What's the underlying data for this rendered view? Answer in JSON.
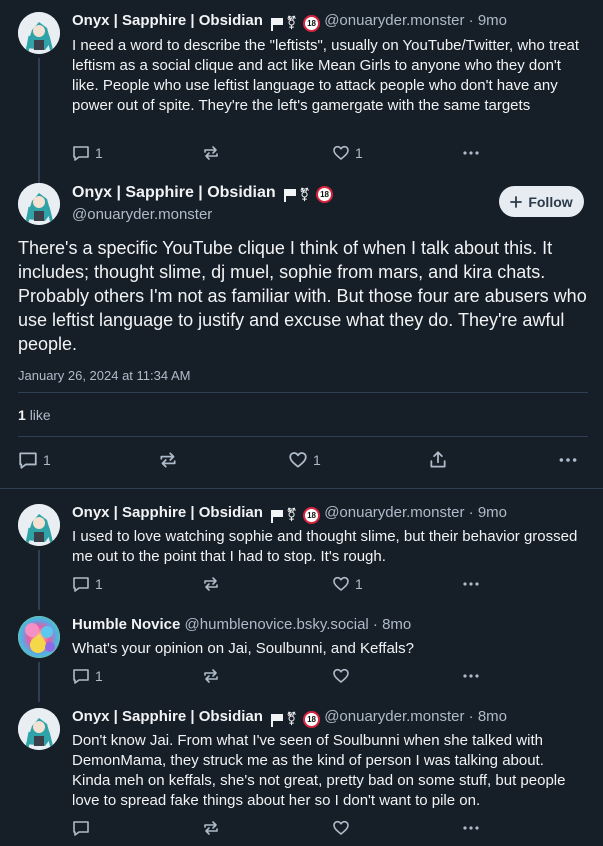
{
  "posts": [
    {
      "name": "Onyx | Sapphire | Obsidian",
      "handle": "@onuaryder.monster",
      "time": "9mo",
      "text": "I need a word to describe the \"leftists\", usually on YouTube/Twitter, who treat leftism as a social clique and act like Mean Girls to anyone who they don't like. People who use leftist language to attack people who don't have any power out of spite. They're the left's gamergate with the same targets",
      "replies": "1",
      "likes": "1"
    },
    {
      "name": "Onyx | Sapphire | Obsidian",
      "handle": "@onuaryder.monster",
      "time": "9mo",
      "text": "I used to love watching sophie and thought slime, but their behavior grossed me out to the point that I had to stop. It's rough.",
      "replies": "1",
      "likes": "1"
    },
    {
      "name": "Humble Novice",
      "handle": "@humblenovice.bsky.social",
      "time": "8mo",
      "text": "What's your opinion on Jai, Soulbunni, and Keffals?",
      "replies": "1",
      "likes": ""
    },
    {
      "name": "Onyx | Sapphire | Obsidian",
      "handle": "@onuaryder.monster",
      "time": "8mo",
      "text": "Don't know Jai. From what I've seen of Soulbunni when she talked with DemonMama, they struck me as the kind of person I was talking about. Kinda meh on keffals, she's not great, pretty bad on some stuff, but people love to spread fake things about her so I don't want to pile on.",
      "replies": "",
      "likes": ""
    }
  ],
  "main": {
    "name": "Onyx | Sapphire | Obsidian",
    "handle": "@onuaryder.monster",
    "follow_label": "Follow",
    "text": "There's a specific YouTube clique I think of when I talk about this. It includes; thought slime, dj muel, sophie from mars, and kira chats. Probably others I'm not as familiar with. But those four are abusers who use leftist language to justify and excuse what they do. They're awful people.",
    "date": "January 26, 2024 at 11:34 AM",
    "like_count": "1",
    "like_word": "like",
    "replies": "1",
    "likes": "1"
  },
  "badge_18": "18",
  "trans_symbol": "⚧",
  "separator": "·",
  "icons": [
    "reply-icon",
    "repost-icon",
    "like-icon",
    "share-icon",
    "more-icon",
    "plus-icon",
    "flag-icon",
    "trans-symbol-icon",
    "age-18-icon"
  ],
  "colors": {
    "background": "#161e27",
    "text": "#f1f3f5",
    "muted": "#aebbc9",
    "divider": "#2e4052",
    "follow_bg": "#e6ecf2",
    "badge_red": "#d4253f"
  }
}
